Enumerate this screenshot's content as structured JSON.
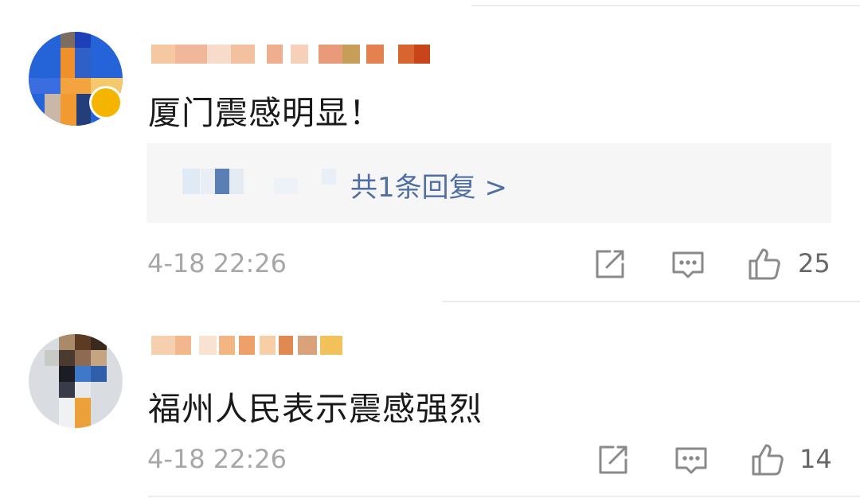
{
  "comments": [
    {
      "text": "厦门震感明显！",
      "reply_link": "共1条回复 >",
      "timestamp": "4-18 22:26",
      "likes": "25",
      "has_badge": true
    },
    {
      "text": "福州人民表示震感强烈",
      "timestamp": "4-18 22:26",
      "likes": "14",
      "has_badge": false
    }
  ],
  "icons": {
    "share": "share-icon",
    "reply": "comment-icon",
    "like": "thumbs-up-icon"
  },
  "colors": {
    "reply_link": "#4f6fa4",
    "timestamp": "#a7a7a7",
    "icon": "#8a8a8a",
    "reply_bg": "#f6f6f6"
  }
}
